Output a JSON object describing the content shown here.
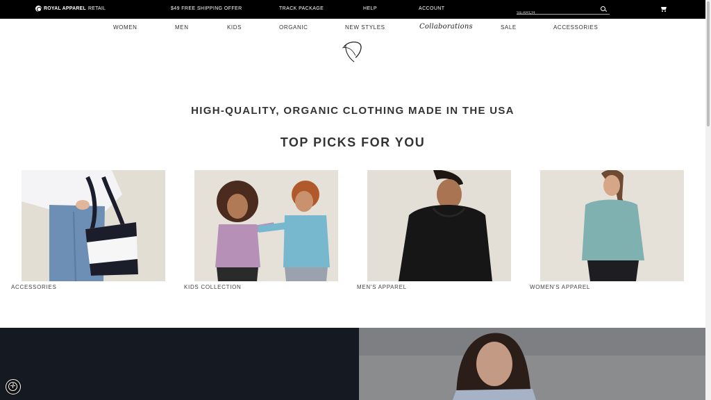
{
  "topbar": {
    "brand_bold": "ROYAL APPAREL",
    "brand_rest": "RETAIL",
    "links": [
      "$49 FREE SHIPPING OFFER",
      "TRACK PACKAGE",
      "HELP",
      "ACCOUNT"
    ],
    "search_placeholder": "SEARCH",
    "search_icon": "search-icon",
    "cart_icon": "cart-icon"
  },
  "nav": {
    "items": [
      "WOMEN",
      "MEN",
      "KIDS",
      "ORGANIC",
      "NEW STYLES",
      "Collaborations",
      "SALE",
      "ACCESSORIES"
    ]
  },
  "hero": {
    "tagline": "HIGH-QUALITY, ORGANIC CLOTHING MADE IN THE USA",
    "heading": "TOP PICKS FOR YOU"
  },
  "products": [
    {
      "label": "ACCESSORIES"
    },
    {
      "label": "KIDS COLLECTION"
    },
    {
      "label": "MEN'S APPAREL"
    },
    {
      "label": "WOMEN'S APPAREL"
    }
  ],
  "colors": {
    "topbar": "#000000",
    "banner_dark": "#151922",
    "photo_background": "#e3ded3"
  },
  "icons": {
    "logo": "swoosh-logo",
    "accessibility": "accessibility-icon"
  }
}
